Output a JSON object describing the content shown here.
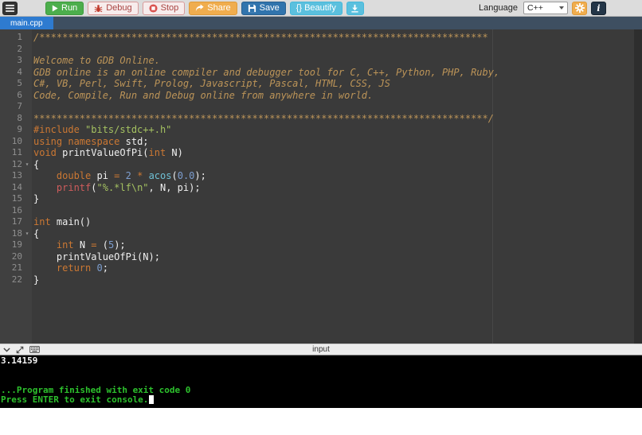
{
  "toolbar": {
    "run_label": "Run",
    "debug_label": "Debug",
    "stop_label": "Stop",
    "share_label": "Share",
    "save_label": "Save",
    "beautify_label": "{} Beautify",
    "language_label": "Language",
    "language_value": "C++"
  },
  "tabs": [
    {
      "label": "main.cpp",
      "active": true
    }
  ],
  "editor": {
    "lines": [
      {
        "n": 1,
        "seg": [
          {
            "t": "/******************************************************************************",
            "c": "com"
          }
        ]
      },
      {
        "n": 2,
        "seg": []
      },
      {
        "n": 3,
        "seg": [
          {
            "t": "Welcome to GDB Online.",
            "c": "com"
          }
        ]
      },
      {
        "n": 4,
        "seg": [
          {
            "t": "GDB online is an online compiler and debugger tool for C, C++, Python, PHP, Ruby,",
            "c": "com"
          }
        ]
      },
      {
        "n": 5,
        "seg": [
          {
            "t": "C#, VB, Perl, Swift, Prolog, Javascript, Pascal, HTML, CSS, JS",
            "c": "com"
          }
        ]
      },
      {
        "n": 6,
        "seg": [
          {
            "t": "Code, Compile, Run and Debug online from anywhere in world.",
            "c": "com"
          }
        ]
      },
      {
        "n": 7,
        "seg": []
      },
      {
        "n": 8,
        "seg": [
          {
            "t": "*******************************************************************************/",
            "c": "com"
          }
        ]
      },
      {
        "n": 9,
        "seg": [
          {
            "t": "#include",
            "c": "kw"
          },
          {
            "t": " "
          },
          {
            "t": "\"bits/stdc++.h\"",
            "c": "str"
          }
        ]
      },
      {
        "n": 10,
        "seg": [
          {
            "t": "using",
            "c": "kw"
          },
          {
            "t": " "
          },
          {
            "t": "namespace",
            "c": "kw"
          },
          {
            "t": " std;"
          }
        ]
      },
      {
        "n": 11,
        "seg": [
          {
            "t": "void",
            "c": "kw"
          },
          {
            "t": " printValueOfPi("
          },
          {
            "t": "int",
            "c": "kw"
          },
          {
            "t": " N)"
          }
        ]
      },
      {
        "n": 12,
        "fold": true,
        "seg": [
          {
            "t": "{"
          }
        ]
      },
      {
        "n": 13,
        "seg": [
          {
            "t": "    "
          },
          {
            "t": "double",
            "c": "kw"
          },
          {
            "t": " pi "
          },
          {
            "t": "=",
            "c": "op"
          },
          {
            "t": " "
          },
          {
            "t": "2",
            "c": "num"
          },
          {
            "t": " "
          },
          {
            "t": "*",
            "c": "op"
          },
          {
            "t": " "
          },
          {
            "t": "acos",
            "c": "fn"
          },
          {
            "t": "("
          },
          {
            "t": "0.0",
            "c": "num"
          },
          {
            "t": ");"
          }
        ]
      },
      {
        "n": 14,
        "seg": [
          {
            "t": "    "
          },
          {
            "t": "printf",
            "c": "io"
          },
          {
            "t": "("
          },
          {
            "t": "\"%.*lf\\n\"",
            "c": "str"
          },
          {
            "t": ", N, pi);"
          }
        ]
      },
      {
        "n": 15,
        "seg": [
          {
            "t": "}"
          }
        ]
      },
      {
        "n": 16,
        "seg": []
      },
      {
        "n": 17,
        "seg": [
          {
            "t": "int",
            "c": "kw"
          },
          {
            "t": " main()"
          }
        ]
      },
      {
        "n": 18,
        "fold": true,
        "seg": [
          {
            "t": "{"
          }
        ]
      },
      {
        "n": 19,
        "seg": [
          {
            "t": "    "
          },
          {
            "t": "int",
            "c": "kw"
          },
          {
            "t": " N "
          },
          {
            "t": "=",
            "c": "op"
          },
          {
            "t": " ("
          },
          {
            "t": "5",
            "c": "num"
          },
          {
            "t": ");"
          }
        ]
      },
      {
        "n": 20,
        "seg": [
          {
            "t": "    printValueOfPi(N);"
          }
        ]
      },
      {
        "n": 21,
        "seg": [
          {
            "t": "    "
          },
          {
            "t": "return",
            "c": "kw"
          },
          {
            "t": " "
          },
          {
            "t": "0",
            "c": "num"
          },
          {
            "t": ";"
          }
        ]
      },
      {
        "n": 22,
        "seg": [
          {
            "t": "}"
          }
        ]
      }
    ]
  },
  "input_bar": {
    "label": "input"
  },
  "console": {
    "lines": [
      {
        "text": "3.14159",
        "color": "white"
      },
      {
        "text": "",
        "color": "white"
      },
      {
        "text": "",
        "color": "white"
      },
      {
        "text": "...Program finished with exit code 0",
        "color": "green"
      },
      {
        "text": "Press ENTER to exit console.",
        "color": "green",
        "cursor": true
      }
    ]
  },
  "icons": {
    "menu": "hamburger",
    "run": "play-triangle",
    "debug": "bug",
    "stop": "stop-circle",
    "share": "curved-arrow",
    "save": "floppy-disk",
    "download": "download-arrow",
    "settings": "gear",
    "info": "i",
    "console_collapse": "chevron-down",
    "console_resize": "diagonal-arrows",
    "console_keyboard": "keyboard",
    "fold": "triangle-down"
  },
  "colors": {
    "run_green": "#4cae4c",
    "share_orange": "#f0ad4e",
    "save_blue": "#3174ad",
    "beautify_blue": "#5bc0de",
    "tab_active_blue": "#2e7bd0",
    "tabbar_bg": "#3e4f61",
    "editor_bg": "#3a3a3a",
    "comment": "#bc9458",
    "keyword": "#cc7833",
    "string": "#a5c261",
    "number": "#7d9ecf",
    "console_green": "#2dc22d"
  }
}
